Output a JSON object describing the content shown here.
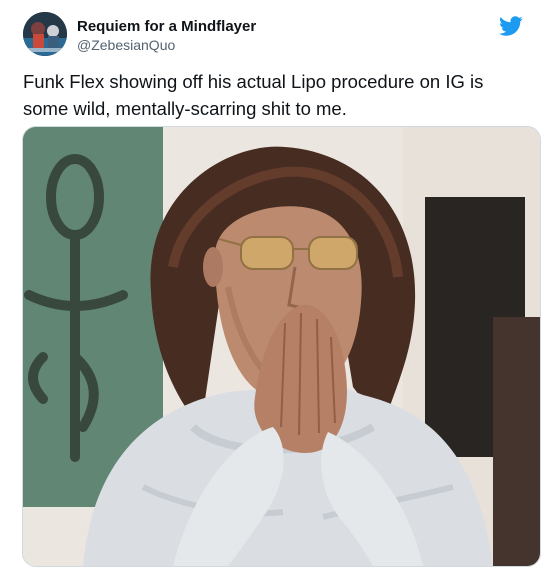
{
  "tweet": {
    "author": {
      "display_name": "Requiem for a Mindflayer",
      "handle": "@ZebesianQuo",
      "avatar_icon": "avatar-icon"
    },
    "platform_icon": "twitter-bird-icon",
    "text": "Funk Flex showing off his actual Lipo procedure on IG is some wild, mentally-scarring shit to me.",
    "media": {
      "type": "photo",
      "icon": "photo-icon"
    }
  },
  "colors": {
    "twitter_blue": "#1d9bf0",
    "text_primary": "#0f1419",
    "text_secondary": "#536471",
    "border": "#cfd9de"
  }
}
